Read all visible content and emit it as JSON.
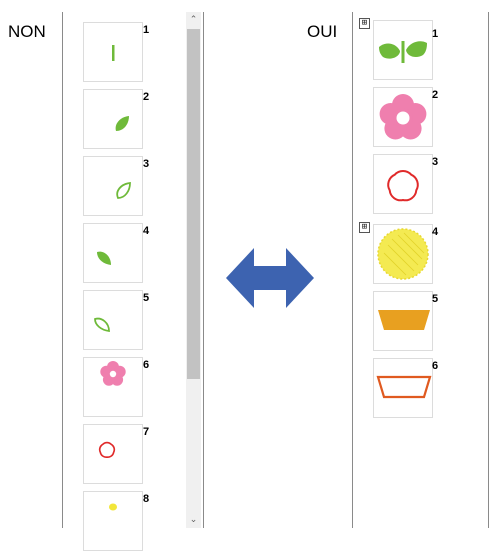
{
  "labels": {
    "left": "NON",
    "right": "OUI"
  },
  "colors": {
    "leaf_green": "#6fba3a",
    "flower_pink": "#ef7fae",
    "outline_red": "#e02a2a",
    "sun_yellow": "#f2e63a",
    "pot_orange": "#e8a020",
    "arrow_blue": "#3d63b0"
  },
  "left_list": {
    "items": [
      {
        "number": "1",
        "icon": "stem-icon"
      },
      {
        "number": "2",
        "icon": "leaf-icon"
      },
      {
        "number": "3",
        "icon": "leaf-outline-icon"
      },
      {
        "number": "4",
        "icon": "leaf-icon"
      },
      {
        "number": "5",
        "icon": "leaf-outline-icon"
      },
      {
        "number": "6",
        "icon": "flower-icon"
      },
      {
        "number": "7",
        "icon": "flower-outline-icon"
      },
      {
        "number": "8",
        "icon": "dot-icon"
      }
    ]
  },
  "right_list": {
    "items": [
      {
        "number": "1",
        "icon": "leaves-stem-icon",
        "expander": "⊞"
      },
      {
        "number": "2",
        "icon": "flower-icon"
      },
      {
        "number": "3",
        "icon": "flower-outline-icon"
      },
      {
        "number": "4",
        "icon": "sun-icon",
        "expander": "⊞"
      },
      {
        "number": "5",
        "icon": "pot-icon"
      },
      {
        "number": "6",
        "icon": "pot-outline-icon"
      }
    ]
  }
}
